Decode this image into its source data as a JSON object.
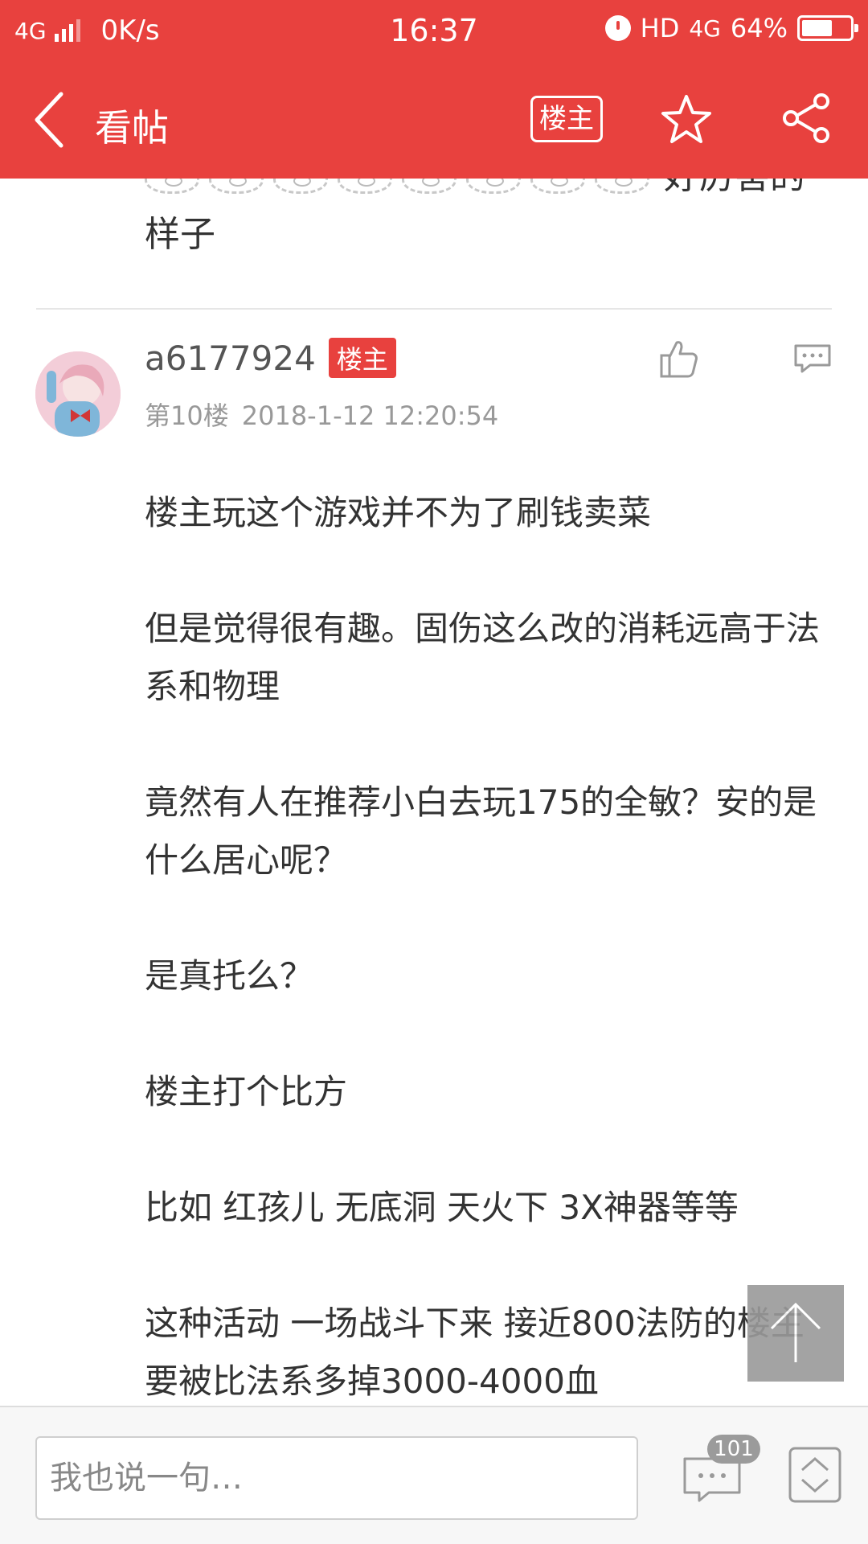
{
  "status_bar": {
    "network": "4G",
    "speed": "0K/s",
    "time": "16:37",
    "hd": "HD",
    "network_right": "4G",
    "battery_level": "64%",
    "battery_fraction": 0.64
  },
  "nav": {
    "title": "看帖",
    "louzhu_filter": "楼主",
    "icons": [
      "back-icon",
      "star-icon",
      "share-icon"
    ]
  },
  "previous_post": {
    "emoji_count": 8,
    "text_tail": "好厉害的",
    "text_line2": "样子"
  },
  "post": {
    "author": "a6177924",
    "badge": "楼主",
    "floor": "第10楼",
    "timestamp": "2018-1-12 12:20:54",
    "paragraphs": [
      "楼主玩这个游戏并不为了刷钱卖菜",
      "但是觉得很有趣。固伤这么改的消耗远高于法系和物理",
      "竟然有人在推荐小白去玩175的全敏？安的是什么居心呢？",
      "是真托么？",
      "楼主打个比方",
      "比如 红孩儿 无底洞 天火下 3X神器等等",
      "这种活动 一场战斗下来 接近800法防的楼主要被比法系多掉3000-4000血"
    ]
  },
  "bottom_bar": {
    "reply_placeholder": "我也说一句…",
    "comment_count": "101"
  },
  "colors": {
    "brand_red": "#e8413e",
    "text": "#333333",
    "muted": "#999999"
  }
}
